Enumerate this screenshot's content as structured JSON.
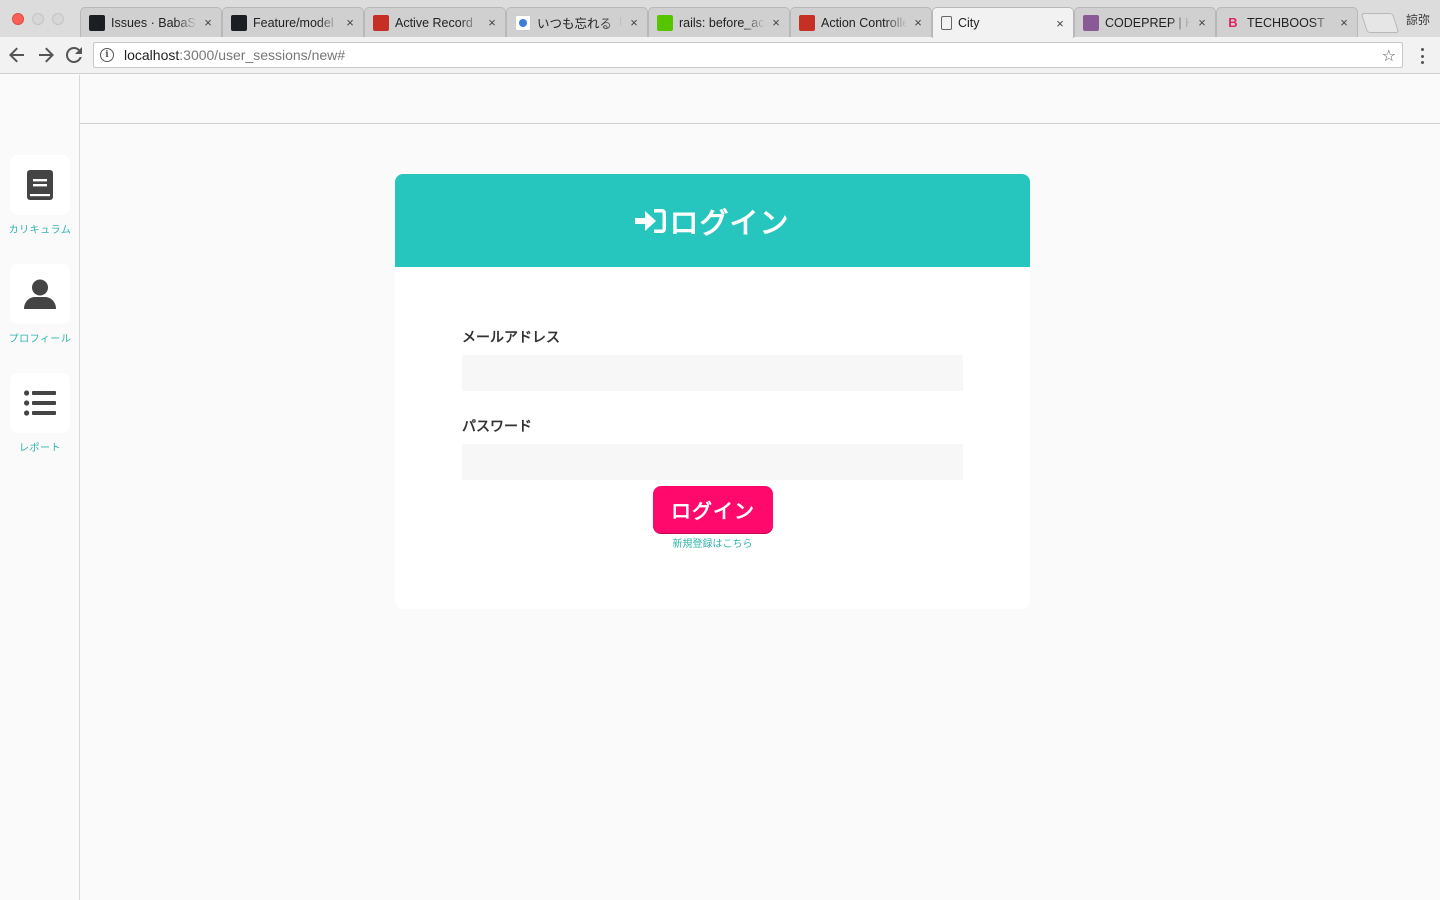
{
  "browser": {
    "tabs": [
      {
        "title": "Issues · BabaSh",
        "favicon": "github-icon"
      },
      {
        "title": "Feature/model",
        "favicon": "github-icon"
      },
      {
        "title": "Active Record",
        "favicon": "rails-icon"
      },
      {
        "title": "いつも忘れる「R",
        "favicon": "search-icon"
      },
      {
        "title": "rails: before_ac",
        "favicon": "qiita-icon"
      },
      {
        "title": "Action Controlle",
        "favicon": "rails-icon"
      },
      {
        "title": "City",
        "favicon": "document-icon",
        "active": true
      },
      {
        "title": "CODEPREP | HT",
        "favicon": "codeprep-icon"
      },
      {
        "title": "TECHBOOST",
        "favicon": "techboost-icon"
      }
    ],
    "close_glyph": "×",
    "user": "諒弥",
    "url_host": "localhost",
    "url_path": ":3000/user_sessions/new#"
  },
  "sidebar": {
    "items": [
      {
        "label": "カリキュラム",
        "icon": "book-icon"
      },
      {
        "label": "プロフィール",
        "icon": "user-icon"
      },
      {
        "label": "レポート",
        "icon": "list-icon"
      }
    ]
  },
  "login": {
    "title": "ログイン",
    "email_label": "メールアドレス",
    "email_value": "",
    "password_label": "パスワード",
    "password_value": "",
    "submit_label": "ログイン",
    "signup_link": "新規登録はこちら"
  },
  "colors": {
    "header_teal": "#26c6bf",
    "button_pink": "#ff0a6c",
    "link_teal": "#2fb3ab",
    "icon_gray": "#444444"
  }
}
